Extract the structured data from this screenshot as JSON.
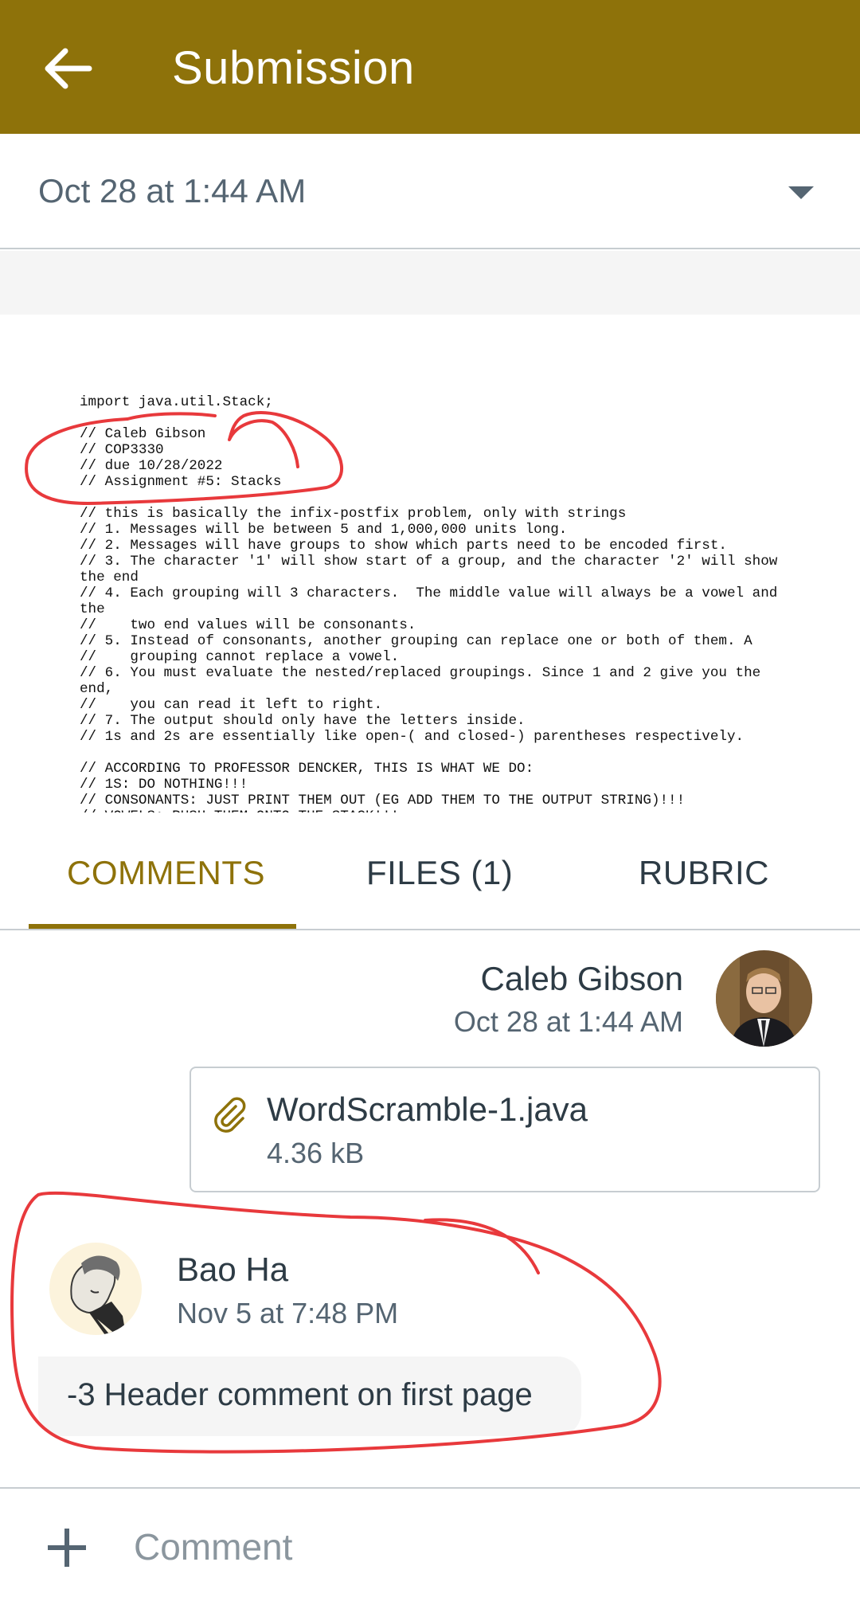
{
  "header": {
    "title": "Submission",
    "back_icon": "arrow-left-icon"
  },
  "attempt": {
    "label": "Oct 28 at 1:44 AM",
    "dropdown_icon": "caret-down-icon"
  },
  "preview": {
    "code_lines": [
      "import java.util.Stack;",
      "",
      "// Caleb Gibson",
      "// COP3330",
      "// due 10/28/2022",
      "// Assignment #5: Stacks",
      "",
      "// this is basically the infix-postfix problem, only with strings",
      "// 1. Messages will be between 5 and 1,000,000 units long.",
      "// 2. Messages will have groups to show which parts need to be encoded first.",
      "// 3. The character '1' will show start of a group, and the character '2' will show",
      "the end",
      "// 4. Each grouping will 3 characters.  The middle value will always be a vowel and",
      "the",
      "//    two end values will be consonants.",
      "// 5. Instead of consonants, another grouping can replace one or both of them. A",
      "//    grouping cannot replace a vowel.",
      "// 6. You must evaluate the nested/replaced groupings. Since 1 and 2 give you the",
      "end,",
      "//    you can read it left to right.",
      "// 7. The output should only have the letters inside.",
      "// 1s and 2s are essentially like open-( and closed-) parentheses respectively.",
      "",
      "// ACCORDING TO PROFESSOR DENCKER, THIS IS WHAT WE DO:",
      "// 1S: DO NOTHING!!!",
      "// CONSONANTS: JUST PRINT THEM OUT (EG ADD THEM TO THE OUTPUT STRING)!!!",
      "// VOWELS: PUSH THEM ONTO THE STACK!!!"
    ],
    "annotation_color": "#e8393c"
  },
  "tabs": [
    {
      "label": "COMMENTS",
      "active": true
    },
    {
      "label": "FILES (1)",
      "active": false
    },
    {
      "label": "RUBRIC",
      "active": false
    }
  ],
  "comments": {
    "student": {
      "name": "Caleb Gibson",
      "date": "Oct 28 at 1:44 AM",
      "file": {
        "name": "WordScramble-1.java",
        "size": "4.36 kB",
        "icon": "paperclip-icon"
      }
    },
    "grader": {
      "name": "Bao Ha",
      "date": "Nov 5 at 7:48 PM",
      "text": "-3 Header comment on first page"
    }
  },
  "composer": {
    "placeholder": "Comment",
    "add_icon": "plus-icon"
  },
  "colors": {
    "brand": "#8e720a",
    "text": "#2d3b45",
    "muted": "#556572",
    "annotation": "#e8393c"
  }
}
